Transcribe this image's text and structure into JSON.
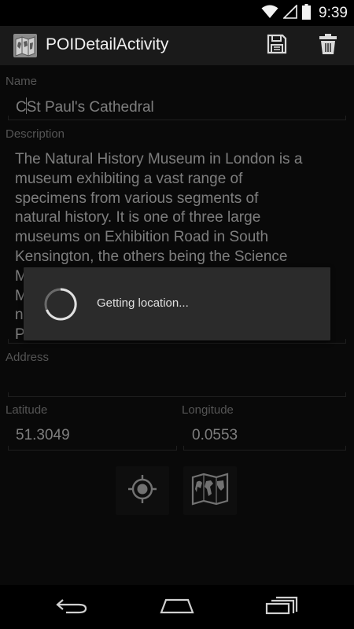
{
  "status_bar": {
    "time": "9:39",
    "icons": [
      "wifi-icon",
      "signal-icon",
      "battery-icon"
    ]
  },
  "action_bar": {
    "title": "POIDetailActivity",
    "actions": [
      "save-icon",
      "delete-icon"
    ]
  },
  "form": {
    "name_label": "Name",
    "name_value": "St Paul's Cathedral",
    "name_prefix": "C",
    "description_label": "Description",
    "description_lines": [
      "The Natural History Museum in London is a",
      "museum exhibiting a vast range of",
      "specimens from various segments of",
      "natural history. It is one of three large",
      "museums on Exhibition Road in South",
      "Kensington, the others being the Science",
      "M",
      "M",
      "n",
      "P"
    ],
    "address_label": "Address",
    "address_value": "",
    "latitude_label": "Latitude",
    "latitude_value": "51.3049",
    "longitude_label": "Longitude",
    "longitude_value": "0.0553"
  },
  "tools": [
    "locate-icon",
    "map-icon"
  ],
  "progress_dialog": {
    "message": "Getting location..."
  },
  "nav_bar": [
    "back-icon",
    "home-icon",
    "recents-icon"
  ],
  "colors": {
    "background": "#111111",
    "action_bar": "#1a1a1a",
    "dialog": "#2b2b2b",
    "text": "#e3e3e3",
    "label": "#9a9a9a"
  }
}
